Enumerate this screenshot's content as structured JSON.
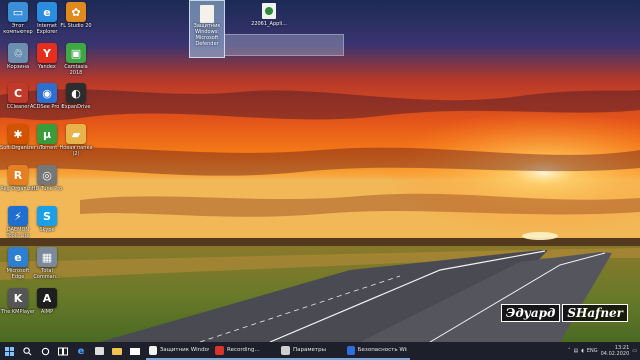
{
  "desktop_icons": [
    {
      "name": "this-pc-icon",
      "label": "Этот компьютер",
      "color": "#3b8fd9",
      "glyph": "▭",
      "col": 0,
      "row": 0
    },
    {
      "name": "recycle-bin-icon",
      "label": "Корзина",
      "color": "#6b8fb0",
      "glyph": "♲",
      "col": 0,
      "row": 1
    },
    {
      "name": "ccleaner-icon",
      "label": "CCleaner",
      "color": "#c0392b",
      "glyph": "C",
      "col": 0,
      "row": 2
    },
    {
      "name": "soft-organizer-icon",
      "label": "Soft Organizer",
      "color": "#d35400",
      "glyph": "✱",
      "col": 0,
      "row": 3
    },
    {
      "name": "reg-organizer-icon",
      "label": "Reg Organizer",
      "color": "#e67e22",
      "glyph": "R",
      "col": 0,
      "row": 4
    },
    {
      "name": "daemon-tools-icon",
      "label": "DAEMON Tools Lite",
      "color": "#1f6fd1",
      "glyph": "⚡",
      "col": 0,
      "row": 5
    },
    {
      "name": "edge-icon",
      "label": "Microsoft Edge",
      "color": "#2c7fd3",
      "glyph": "e",
      "col": 0,
      "row": 6
    },
    {
      "name": "kmplayer-icon",
      "label": "The KMPlayer",
      "color": "#555",
      "glyph": "K",
      "col": 0,
      "row": 7
    },
    {
      "name": "ie-icon",
      "label": "Internet Explorer",
      "color": "#2b8de0",
      "glyph": "e",
      "col": 1,
      "row": 0
    },
    {
      "name": "yandex-icon",
      "label": "Yandex",
      "color": "#e62e1f",
      "glyph": "Y",
      "col": 1,
      "row": 1
    },
    {
      "name": "acdsee-icon",
      "label": "ACDSee Pro 6",
      "color": "#2d6fd0",
      "glyph": "◉",
      "col": 1,
      "row": 2
    },
    {
      "name": "utorrent-icon",
      "label": "uTorrent",
      "color": "#3a9b3a",
      "glyph": "µ",
      "col": 1,
      "row": 3
    },
    {
      "name": "hd-tune-icon",
      "label": "HD Tune Pro",
      "color": "#777",
      "glyph": "◎",
      "col": 1,
      "row": 4
    },
    {
      "name": "skype-icon",
      "label": "Skype",
      "color": "#1aa0e8",
      "glyph": "S",
      "col": 1,
      "row": 5
    },
    {
      "name": "total-commander-icon",
      "label": "Total Comman...",
      "color": "#7a8a9a",
      "glyph": "▦",
      "col": 1,
      "row": 6
    },
    {
      "name": "aimp-icon",
      "label": "AIMP",
      "color": "#1e1e1e",
      "glyph": "A",
      "col": 1,
      "row": 7
    },
    {
      "name": "fl-studio-icon",
      "label": "FL Studio 20",
      "color": "#e08a1e",
      "glyph": "✿",
      "col": 2,
      "row": 0
    },
    {
      "name": "camtasia-icon",
      "label": "Camtasia 2018",
      "color": "#3ea844",
      "glyph": "▣",
      "col": 2,
      "row": 1
    },
    {
      "name": "expandrive-icon",
      "label": "ExpanDrive",
      "color": "#2d2d2d",
      "glyph": "◐",
      "col": 2,
      "row": 2
    },
    {
      "name": "new-folder-icon",
      "label": "Новая папка (2)",
      "color": "#e8b34a",
      "glyph": "▰",
      "col": 2,
      "row": 3
    }
  ],
  "selected_file": {
    "label": "Защитник Windows: Microsoft Defender"
  },
  "app_file": {
    "label": "22061_Appli..."
  },
  "watermark": {
    "part1": "Эдуард",
    "part2": "SHafner"
  },
  "taskbar": {
    "apps": [
      {
        "name": "tb-app-defender",
        "label": "Защитник Window...",
        "color": "#f2f2f2"
      },
      {
        "name": "tb-app-recording",
        "label": "Recording...",
        "color": "#d9342b"
      },
      {
        "name": "tb-app-settings",
        "label": "Параметры",
        "color": "#cfcfcf"
      },
      {
        "name": "tb-app-security",
        "label": "Безопасность Win...",
        "color": "#2f6ee0"
      }
    ],
    "lang": "ENG",
    "time": "13:21",
    "date": "04.02.2020"
  }
}
